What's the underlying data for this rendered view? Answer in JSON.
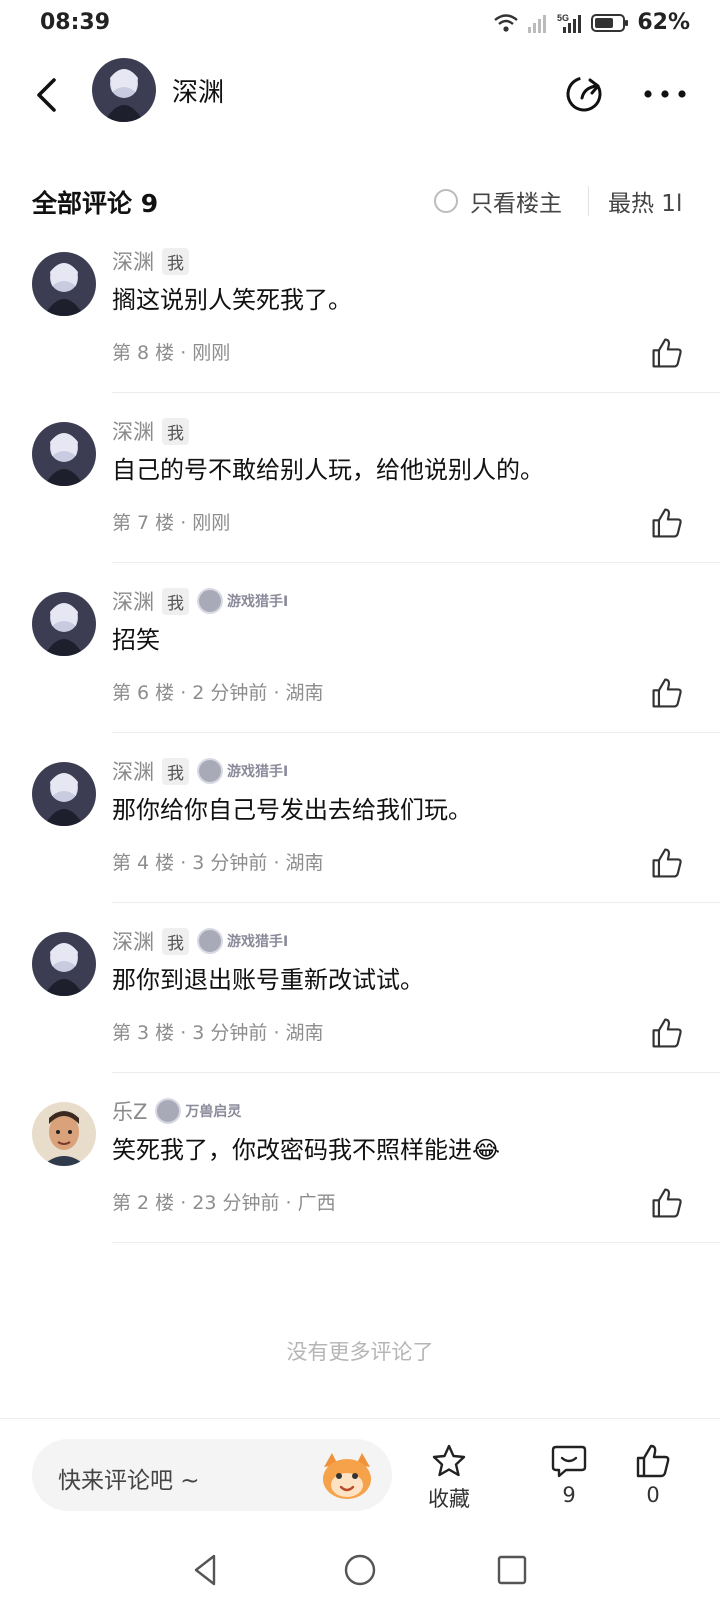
{
  "status": {
    "time": "08:39",
    "battery": "62%",
    "network": "5G"
  },
  "header": {
    "title": "深渊"
  },
  "section": {
    "title": "全部评论 9",
    "only_op": "只看楼主",
    "sort": "最热 1l"
  },
  "comments": [
    {
      "name": "深渊",
      "me": "我",
      "title": "",
      "text": "搁这说别人笑死我了。",
      "meta": "第 8 楼 · 刚刚"
    },
    {
      "name": "深渊",
      "me": "我",
      "title": "",
      "text": "自己的号不敢给别人玩，给他说别人的。",
      "meta": "第 7 楼 · 刚刚"
    },
    {
      "name": "深渊",
      "me": "我",
      "title": "游戏猎手I",
      "text": "招笑",
      "meta": "第 6 楼 · 2 分钟前 · 湖南"
    },
    {
      "name": "深渊",
      "me": "我",
      "title": "游戏猎手I",
      "text": "那你给你自己号发出去给我们玩。",
      "meta": "第 4 楼 · 3 分钟前 · 湖南"
    },
    {
      "name": "深渊",
      "me": "我",
      "title": "游戏猎手I",
      "text": "那你到退出账号重新改试试。",
      "meta": "第 3 楼 · 3 分钟前 · 湖南"
    },
    {
      "name": "乐Z",
      "me": "",
      "title": "万兽启灵",
      "text": "笑死我了，你改密码我不照样能进😂",
      "meta": "第 2 楼 · 23 分钟前 · 广西"
    }
  ],
  "footer": {
    "no_more": "没有更多评论了",
    "input_placeholder": "快来评论吧 ~",
    "collect_label": "收藏",
    "comment_count": "9",
    "like_count": "0"
  },
  "icons": {
    "back": "chevron-left-icon",
    "share": "share-icon",
    "more": "more-horizontal-icon",
    "like": "thumbs-up-icon",
    "star": "star-icon",
    "comment": "comment-bubble-icon"
  }
}
